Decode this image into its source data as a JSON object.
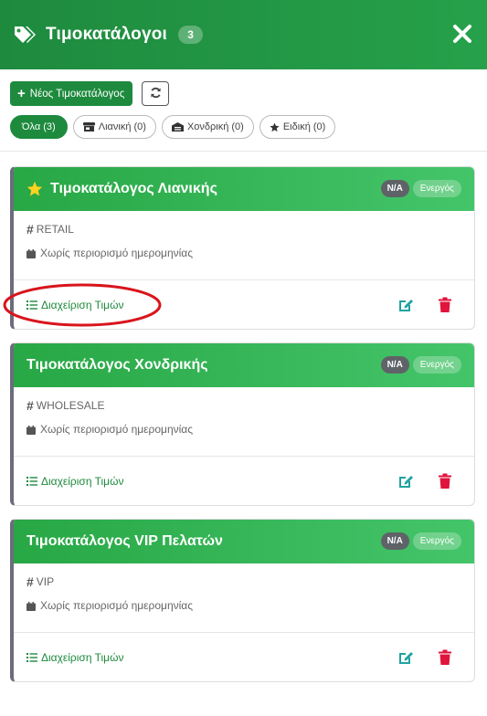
{
  "header": {
    "title": "Τιμοκατάλογοι",
    "count": "3",
    "icon": "tags-icon",
    "close_icon": "close-icon"
  },
  "toolbar": {
    "new_label": "Νέος Τιμοκατάλογος",
    "refresh_icon": "refresh-icon"
  },
  "filters": [
    {
      "label": "Όλα (3)",
      "active": true
    },
    {
      "label": "Λιανική (0)",
      "icon": "store-icon"
    },
    {
      "label": "Χονδρική (0)",
      "icon": "warehouse-icon"
    },
    {
      "label": "Ειδική (0)",
      "icon": "star-icon"
    }
  ],
  "cards": [
    {
      "title": "Τιμοκατάλογος Λιανικής",
      "starred": true,
      "badge_na": "N/A",
      "badge_status": "Ενεργός",
      "code": "RETAIL",
      "date_text": "Χωρίς περιορισμό ημερομηνίας",
      "manage_label": "Διαχείριση Τιμών"
    },
    {
      "title": "Τιμοκατάλογος Χονδρικής",
      "starred": false,
      "badge_na": "N/A",
      "badge_status": "Ενεργός",
      "code": "WHOLESALE",
      "date_text": "Χωρίς περιορισμό ημερομηνίας",
      "manage_label": "Διαχείριση Τιμών"
    },
    {
      "title": "Τιμοκατάλογος VIP Πελατών",
      "starred": false,
      "badge_na": "N/A",
      "badge_status": "Ενεργός",
      "code": "VIP",
      "date_text": "Χωρίς περιορισμό ημερομηνίας",
      "manage_label": "Διαχείριση Τιμών"
    }
  ],
  "colors": {
    "primary": "#1e8a3e",
    "header_green": "#28a745",
    "danger": "#dc3545",
    "annotation": "#d9141c"
  }
}
